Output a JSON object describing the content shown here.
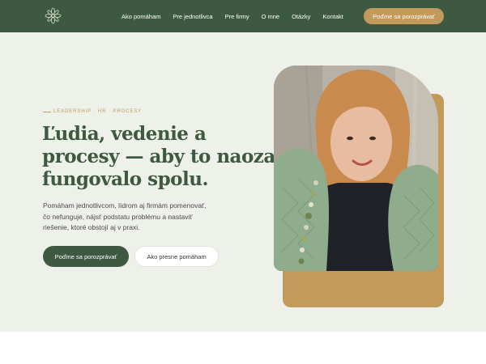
{
  "nav": {
    "logo_icon": "lotus-mandala-logo",
    "links": [
      "Ako pomáham",
      "Pre jednotlivca",
      "Pre firmy",
      "O mne",
      "Otázky",
      "Kontakt"
    ],
    "cta_label": "Poďme sa porozprávať"
  },
  "hero": {
    "eyebrow": "LEADERSHIP · HR · PROCESY",
    "headline_lines": [
      "Ľudia, vedenie a",
      "procesy — aby to naozaj",
      "fungovalo spolu."
    ],
    "description_lines": [
      "Pomáham jednotlivcom, lídrom aj firmám pomenovať,",
      "čo nefunguje, nájsť podstatu problému a nastaviť",
      "riešenie, ktoré obstojí aj v praxi."
    ],
    "primary_button": "Poďme sa porozprávať",
    "secondary_button": "Ako presne pomáham"
  },
  "colors": {
    "primary_green": "#3d5a40",
    "accent_gold": "#c39a5a",
    "hero_background": "#eef0ea"
  }
}
